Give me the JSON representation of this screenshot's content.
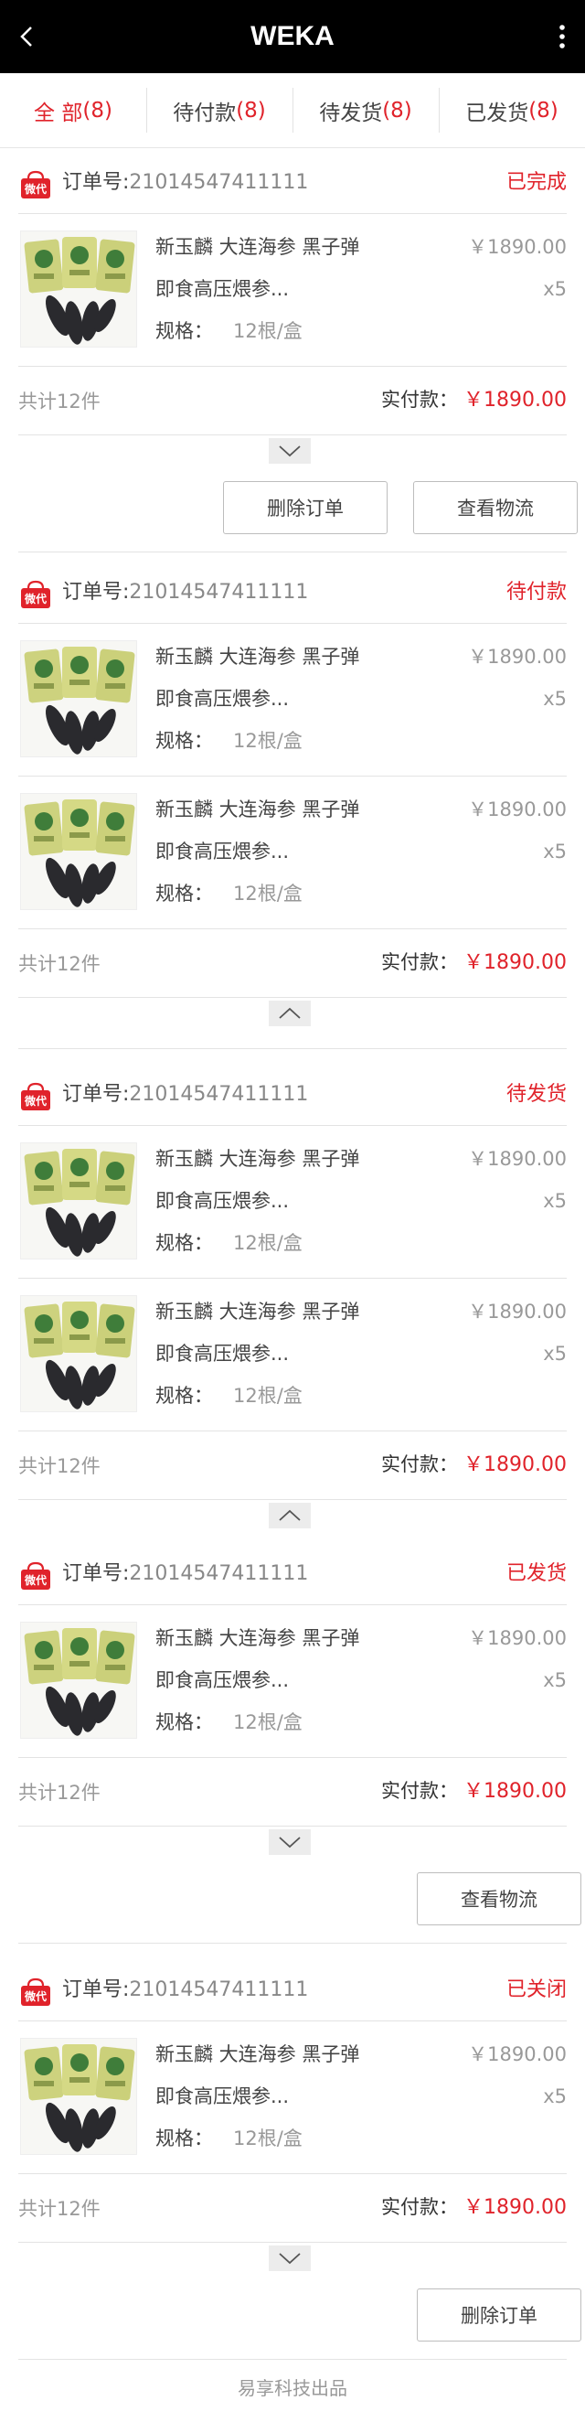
{
  "header": {
    "title": "WEKA"
  },
  "tabs": [
    {
      "label": "全 部",
      "count": "(8)",
      "active": true
    },
    {
      "label": "待付款",
      "count": "(8)",
      "active": false
    },
    {
      "label": "待发货",
      "count": "(8)",
      "active": false
    },
    {
      "label": "已发货",
      "count": "(8)",
      "active": false
    }
  ],
  "colors": {
    "accent": "#e0232b",
    "header_bg": "#000000"
  },
  "product": {
    "name_line1": "新玉麟 大连海参 黑子弹",
    "name_line2": "即食高压煨参...",
    "spec_label": "规格：",
    "spec_value": "12根/盒",
    "price": "￥1890.00",
    "qty": "x5"
  },
  "orders": [
    {
      "order_label": "订单号:",
      "order_no": "21014547411111",
      "status": "已完成",
      "count_text": "共计12件",
      "paid_label": "实付款：",
      "paid_amount": "￥1890.00",
      "buttons": [
        "删除订单",
        "查看物流"
      ]
    },
    {
      "order_label": "订单号:",
      "order_no": "21014547411111",
      "status": "待付款",
      "count_text": "共计12件",
      "paid_label": "实付款：",
      "paid_amount": "￥1890.00",
      "buttons": []
    },
    {
      "order_label": "订单号:",
      "order_no": "21014547411111",
      "status": "待发货",
      "count_text": "共计12件",
      "paid_label": "实付款：",
      "paid_amount": "￥1890.00",
      "buttons": []
    },
    {
      "order_label": "订单号:",
      "order_no": "21014547411111",
      "status": "已发货",
      "count_text": "共计12件",
      "paid_label": "实付款：",
      "paid_amount": "￥1890.00",
      "buttons": [
        "查看物流"
      ]
    },
    {
      "order_label": "订单号:",
      "order_no": "21014547411111",
      "status": "已关闭",
      "count_text": "共计12件",
      "paid_label": "实付款：",
      "paid_amount": "￥1890.00",
      "buttons": [
        "删除订单"
      ]
    }
  ],
  "footer": {
    "text": "易享科技出品"
  }
}
